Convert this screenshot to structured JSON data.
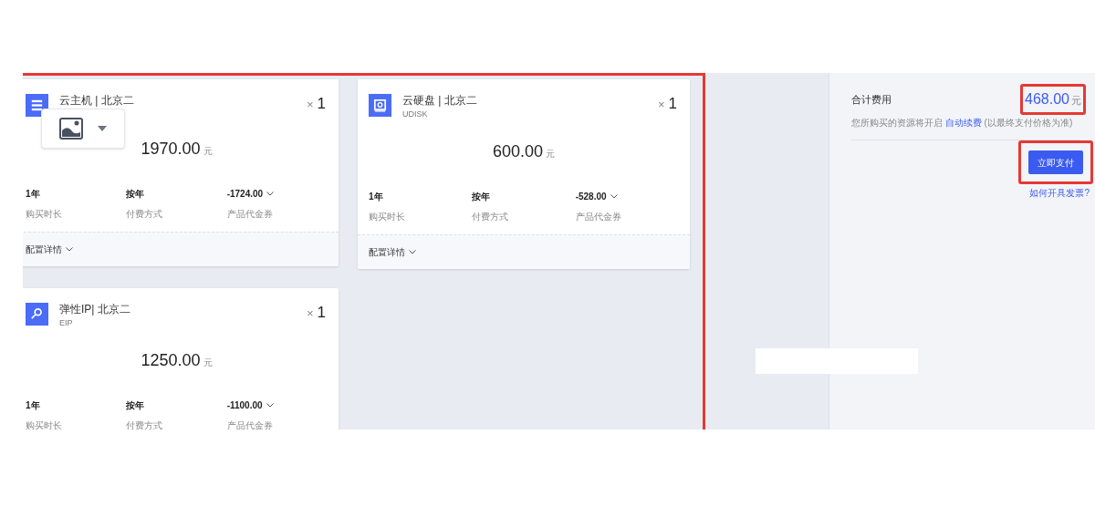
{
  "products": [
    {
      "kind": "server",
      "title": "云主机 | 北京二",
      "quantity_mark": "×",
      "quantity": "1",
      "price": "1970.00",
      "currency": "元",
      "specs": [
        {
          "value": "1年",
          "label": "购买时长",
          "dropdown": false
        },
        {
          "value": "按年",
          "label": "付费方式",
          "dropdown": false
        },
        {
          "value": "-1724.00",
          "label": "产品代金券",
          "dropdown": true
        }
      ],
      "details": "配置详情"
    },
    {
      "kind": "disk",
      "title": "云硬盘 | 北京二",
      "code": "UDISK",
      "quantity_mark": "×",
      "quantity": "1",
      "price": "600.00",
      "currency": "元",
      "specs": [
        {
          "value": "1年",
          "label": "购买时长",
          "dropdown": false
        },
        {
          "value": "按年",
          "label": "付费方式",
          "dropdown": false
        },
        {
          "value": "-528.00",
          "label": "产品代金券",
          "dropdown": true
        }
      ],
      "details": "配置详情"
    },
    {
      "kind": "ip",
      "title": "弹性IP| 北京二",
      "code": "EIP",
      "quantity_mark": "×",
      "quantity": "1",
      "price": "1250.00",
      "currency": "元",
      "specs": [
        {
          "value": "1年",
          "label": "购买时长",
          "dropdown": false
        },
        {
          "value": "按年",
          "label": "付费方式",
          "dropdown": false
        },
        {
          "value": "-1100.00",
          "label": "产品代金券",
          "dropdown": true
        }
      ]
    }
  ],
  "summary": {
    "label": "合计费用",
    "total": "468.00",
    "currency": "元",
    "note_before": "您所购买的资源将开启",
    "note_link": "自动续费",
    "note_after": "(以最终支付价格为准)",
    "pay_button": "立即支付",
    "invoice_link": "如何开具发票?"
  }
}
